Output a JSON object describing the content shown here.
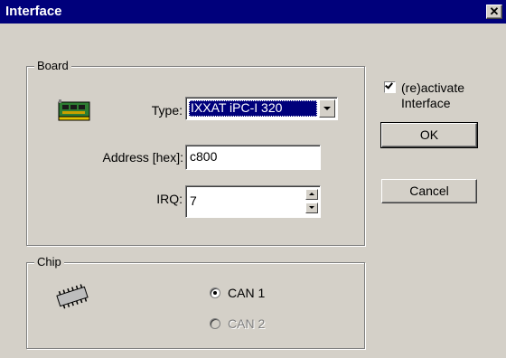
{
  "window": {
    "title": "Interface"
  },
  "board": {
    "group_label": "Board",
    "type_label": "Type:",
    "type_value": "IXXAT iPC-I 320",
    "address_label": "Address [hex]:",
    "address_value": "c800",
    "irq_label": "IRQ:",
    "irq_value": "7",
    "icon": "board-card-icon"
  },
  "chip": {
    "group_label": "Chip",
    "icon": "chip-icon",
    "options": [
      {
        "label": "CAN 1",
        "selected": true,
        "enabled": true
      },
      {
        "label": "CAN 2",
        "selected": false,
        "enabled": false
      }
    ]
  },
  "reactivate": {
    "label_line1": "(re)activate",
    "label_line2": "Interface",
    "checked": true
  },
  "buttons": {
    "ok": "OK",
    "cancel": "Cancel"
  },
  "colors": {
    "titlebar": "#00007b",
    "face": "#d4d0c8",
    "selection": "#00007b"
  }
}
